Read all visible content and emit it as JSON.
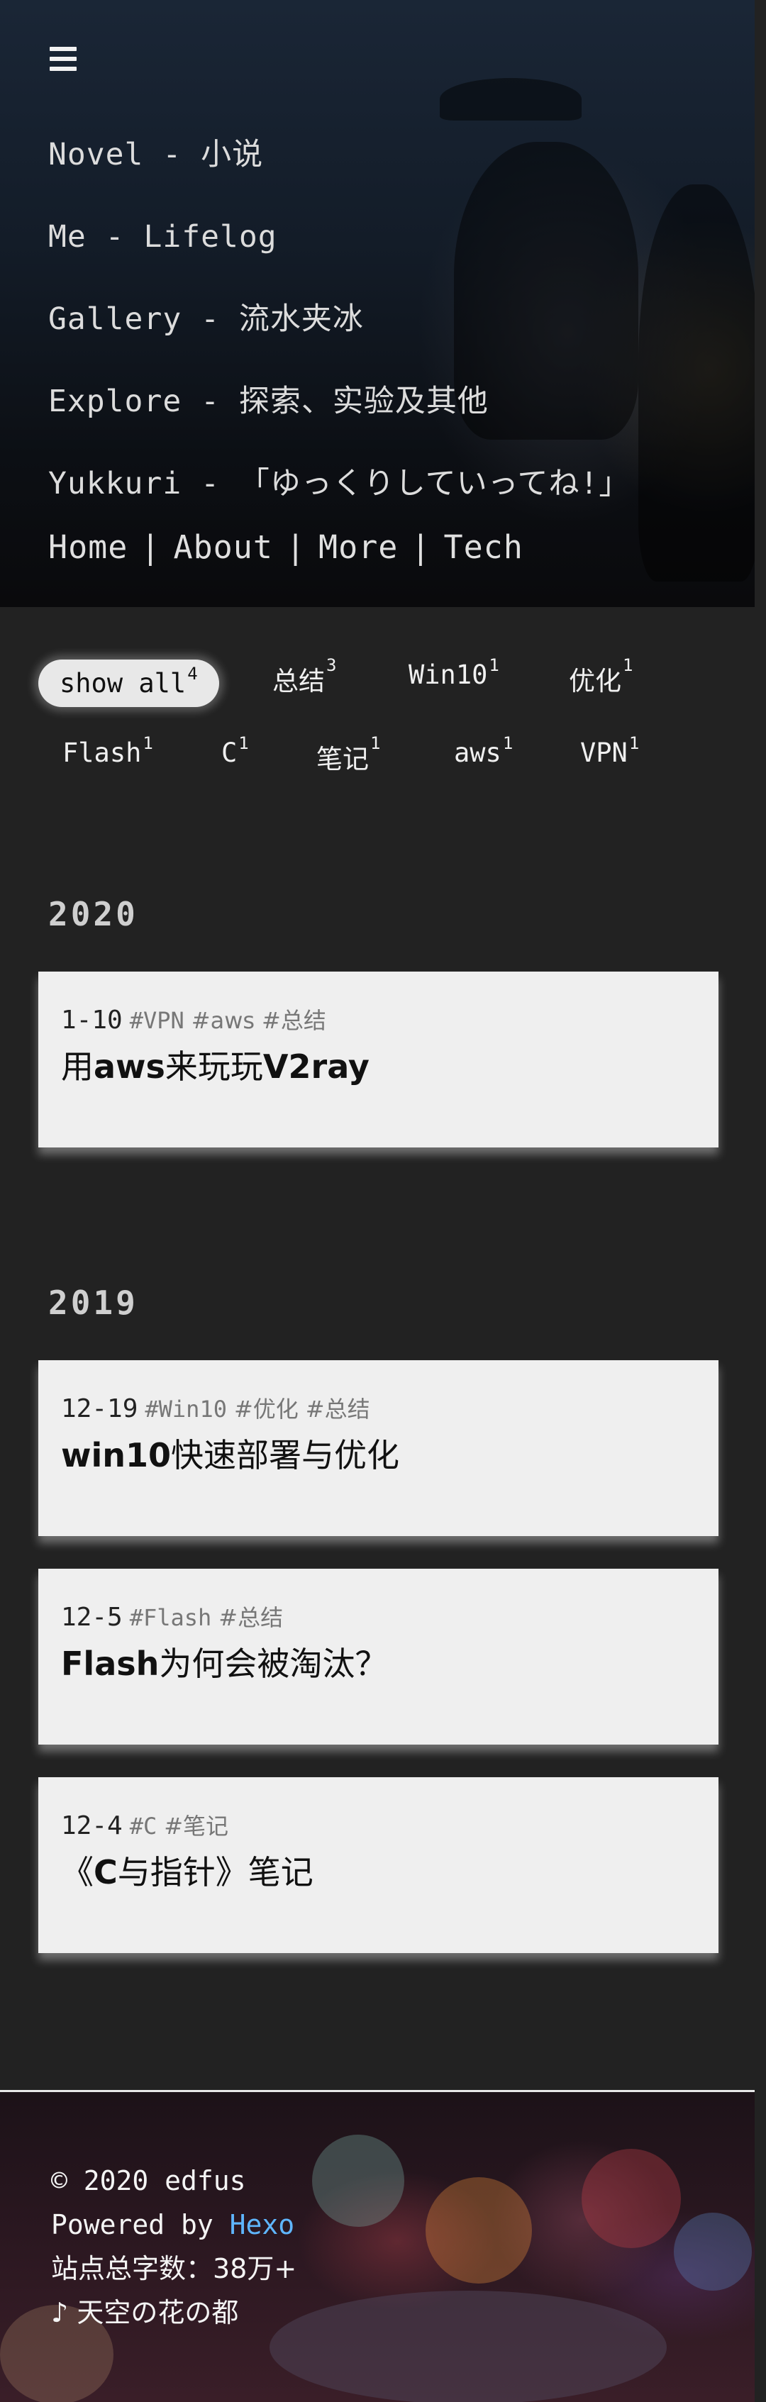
{
  "nav": {
    "items": [
      "Novel - 小说",
      "Me - Lifelog",
      "Gallery - 流水夹冰",
      "Explore - 探索、实验及其他",
      "Yukkuri - 「ゆっくりしていってね!」"
    ],
    "links": [
      "Home",
      "About",
      "More",
      "Tech"
    ],
    "separator": "|",
    "menu_icon": "hamburger-icon"
  },
  "tags": [
    {
      "label": "show all",
      "count": "4",
      "active": true
    },
    {
      "label": "总结",
      "count": "3"
    },
    {
      "label": "Win10",
      "count": "1"
    },
    {
      "label": "优化",
      "count": "1"
    },
    {
      "label": "Flash",
      "count": "1"
    },
    {
      "label": "C",
      "count": "1"
    },
    {
      "label": "笔记",
      "count": "1"
    },
    {
      "label": "aws",
      "count": "1"
    },
    {
      "label": "VPN",
      "count": "1"
    }
  ],
  "archive": [
    {
      "year": "2020",
      "posts": [
        {
          "date": "1-10",
          "tags": [
            "#VPN",
            "#aws",
            "#总结"
          ],
          "title_parts": [
            [
              "用",
              false
            ],
            [
              "aws",
              true
            ],
            [
              "来玩玩",
              false
            ],
            [
              "V2ray",
              true
            ]
          ]
        }
      ]
    },
    {
      "year": "2019",
      "posts": [
        {
          "date": "12-19",
          "tags": [
            "#Win10",
            "#优化",
            "#总结"
          ],
          "title_parts": [
            [
              "win10",
              true
            ],
            [
              "快速部署与优化",
              false
            ]
          ]
        },
        {
          "date": "12-5",
          "tags": [
            "#Flash",
            "#总结"
          ],
          "title_parts": [
            [
              "Flash",
              true
            ],
            [
              "为何会被淘汰？",
              false
            ]
          ]
        },
        {
          "date": "12-4",
          "tags": [
            "#C",
            "#笔记"
          ],
          "title_parts": [
            [
              "《",
              false
            ],
            [
              "C",
              true
            ],
            [
              "与指针》笔记",
              false
            ]
          ]
        }
      ]
    }
  ],
  "footer": {
    "copyright": "© 2020 edfus",
    "powered_prefix": "Powered by ",
    "powered_link": "Hexo",
    "word_count": "站点总字数：38万+",
    "music": "♪ 天空の花の都"
  },
  "colors": {
    "background": "#222222",
    "card": "#efefef",
    "link": "#5fb6ff"
  }
}
